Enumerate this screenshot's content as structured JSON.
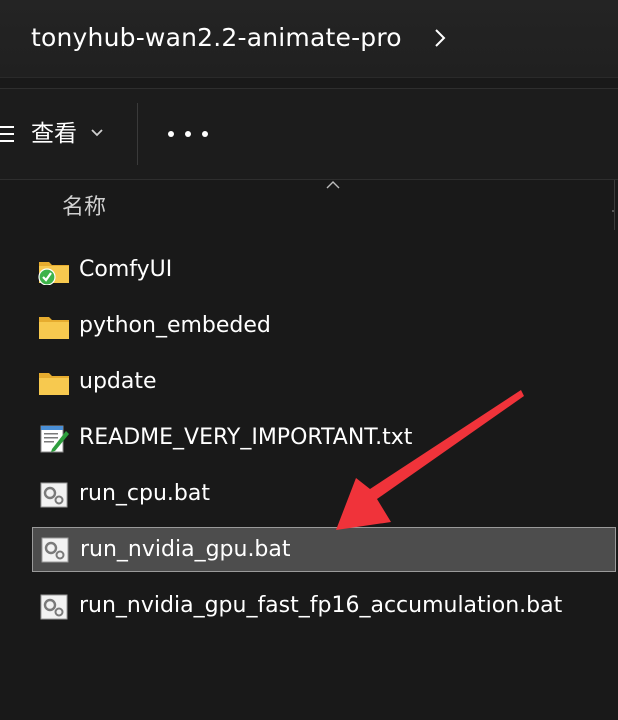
{
  "window": {
    "path": "tonyhub-wan2.2-animate-pro"
  },
  "toolbar": {
    "view_label": "查看",
    "more_label": "…"
  },
  "columns": {
    "name": "名称"
  },
  "files": [
    {
      "name": "ComfyUI",
      "icon": "folder-synced-icon",
      "selected": false
    },
    {
      "name": "python_embeded",
      "icon": "folder-icon",
      "selected": false
    },
    {
      "name": "update",
      "icon": "folder-icon",
      "selected": false
    },
    {
      "name": "README_VERY_IMPORTANT.txt",
      "icon": "text-file-icon",
      "selected": false
    },
    {
      "name": "run_cpu.bat",
      "icon": "batch-file-icon",
      "selected": false
    },
    {
      "name": "run_nvidia_gpu.bat",
      "icon": "batch-file-icon",
      "selected": true
    },
    {
      "name": "run_nvidia_gpu_fast_fp16_accumulation.bat",
      "icon": "batch-file-icon",
      "selected": false
    }
  ],
  "colors": {
    "background": "#191919",
    "selection": "#4d4d4d",
    "folder": "#f4c24e",
    "sync_check": "#3db34a",
    "arrow": "#f0333a"
  }
}
